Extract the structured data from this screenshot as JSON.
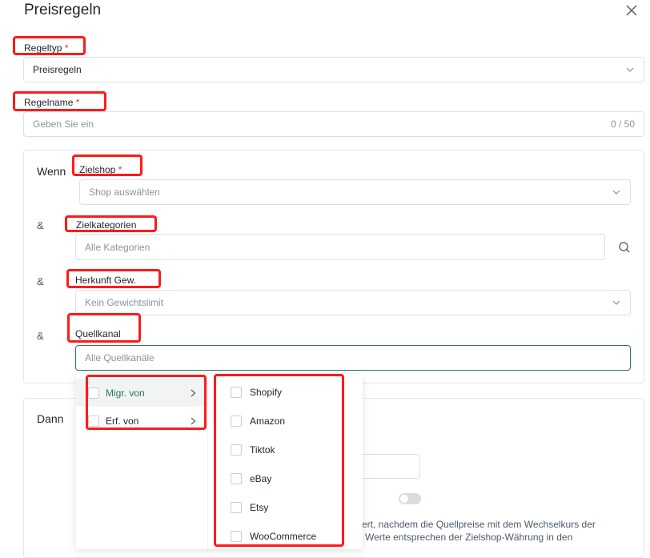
{
  "dialog": {
    "title": "Preisregeln"
  },
  "rule_type": {
    "label": "Regeltyp",
    "required_mark": "*",
    "value": "Preisregeln"
  },
  "rule_name": {
    "label": "Regelname",
    "required_mark": "*",
    "placeholder": "Geben Sie ein",
    "counter": "0 / 50"
  },
  "when_section": {
    "heading": "Wenn",
    "amp": "&",
    "target_shop": {
      "label": "Zielshop",
      "required_mark": "*",
      "placeholder": "Shop auswählen"
    },
    "target_categories": {
      "label": "Zielkategorien",
      "placeholder": "Alle Kategorien"
    },
    "source_weight": {
      "label": "Herkunft Gew.",
      "placeholder": "Kein Gewichtslimit"
    },
    "source_channel": {
      "label": "Quellkanal",
      "placeholder": "Alle Quellkanäle"
    }
  },
  "then_section": {
    "heading": "Dann",
    "note_line1": "ert, nachdem die Quellpreise mit dem Wechselkurs der",
    "note_line2": "Werte entsprechen der Zielshop-Währung in den"
  },
  "channel_dropdown": {
    "groups": [
      {
        "label": "Migr. von",
        "active": true
      },
      {
        "label": "Erf. von",
        "active": false
      }
    ],
    "options": [
      "Shopify",
      "Amazon",
      "Tiktok",
      "eBay",
      "Etsy",
      "WooCommerce"
    ]
  },
  "colors": {
    "highlight_box": "#ff1a1a",
    "required": "#e23434",
    "focus_border": "#2f6f73",
    "active_group_bg": "#f2f3f5",
    "active_group_text": "#1e7d4f"
  }
}
